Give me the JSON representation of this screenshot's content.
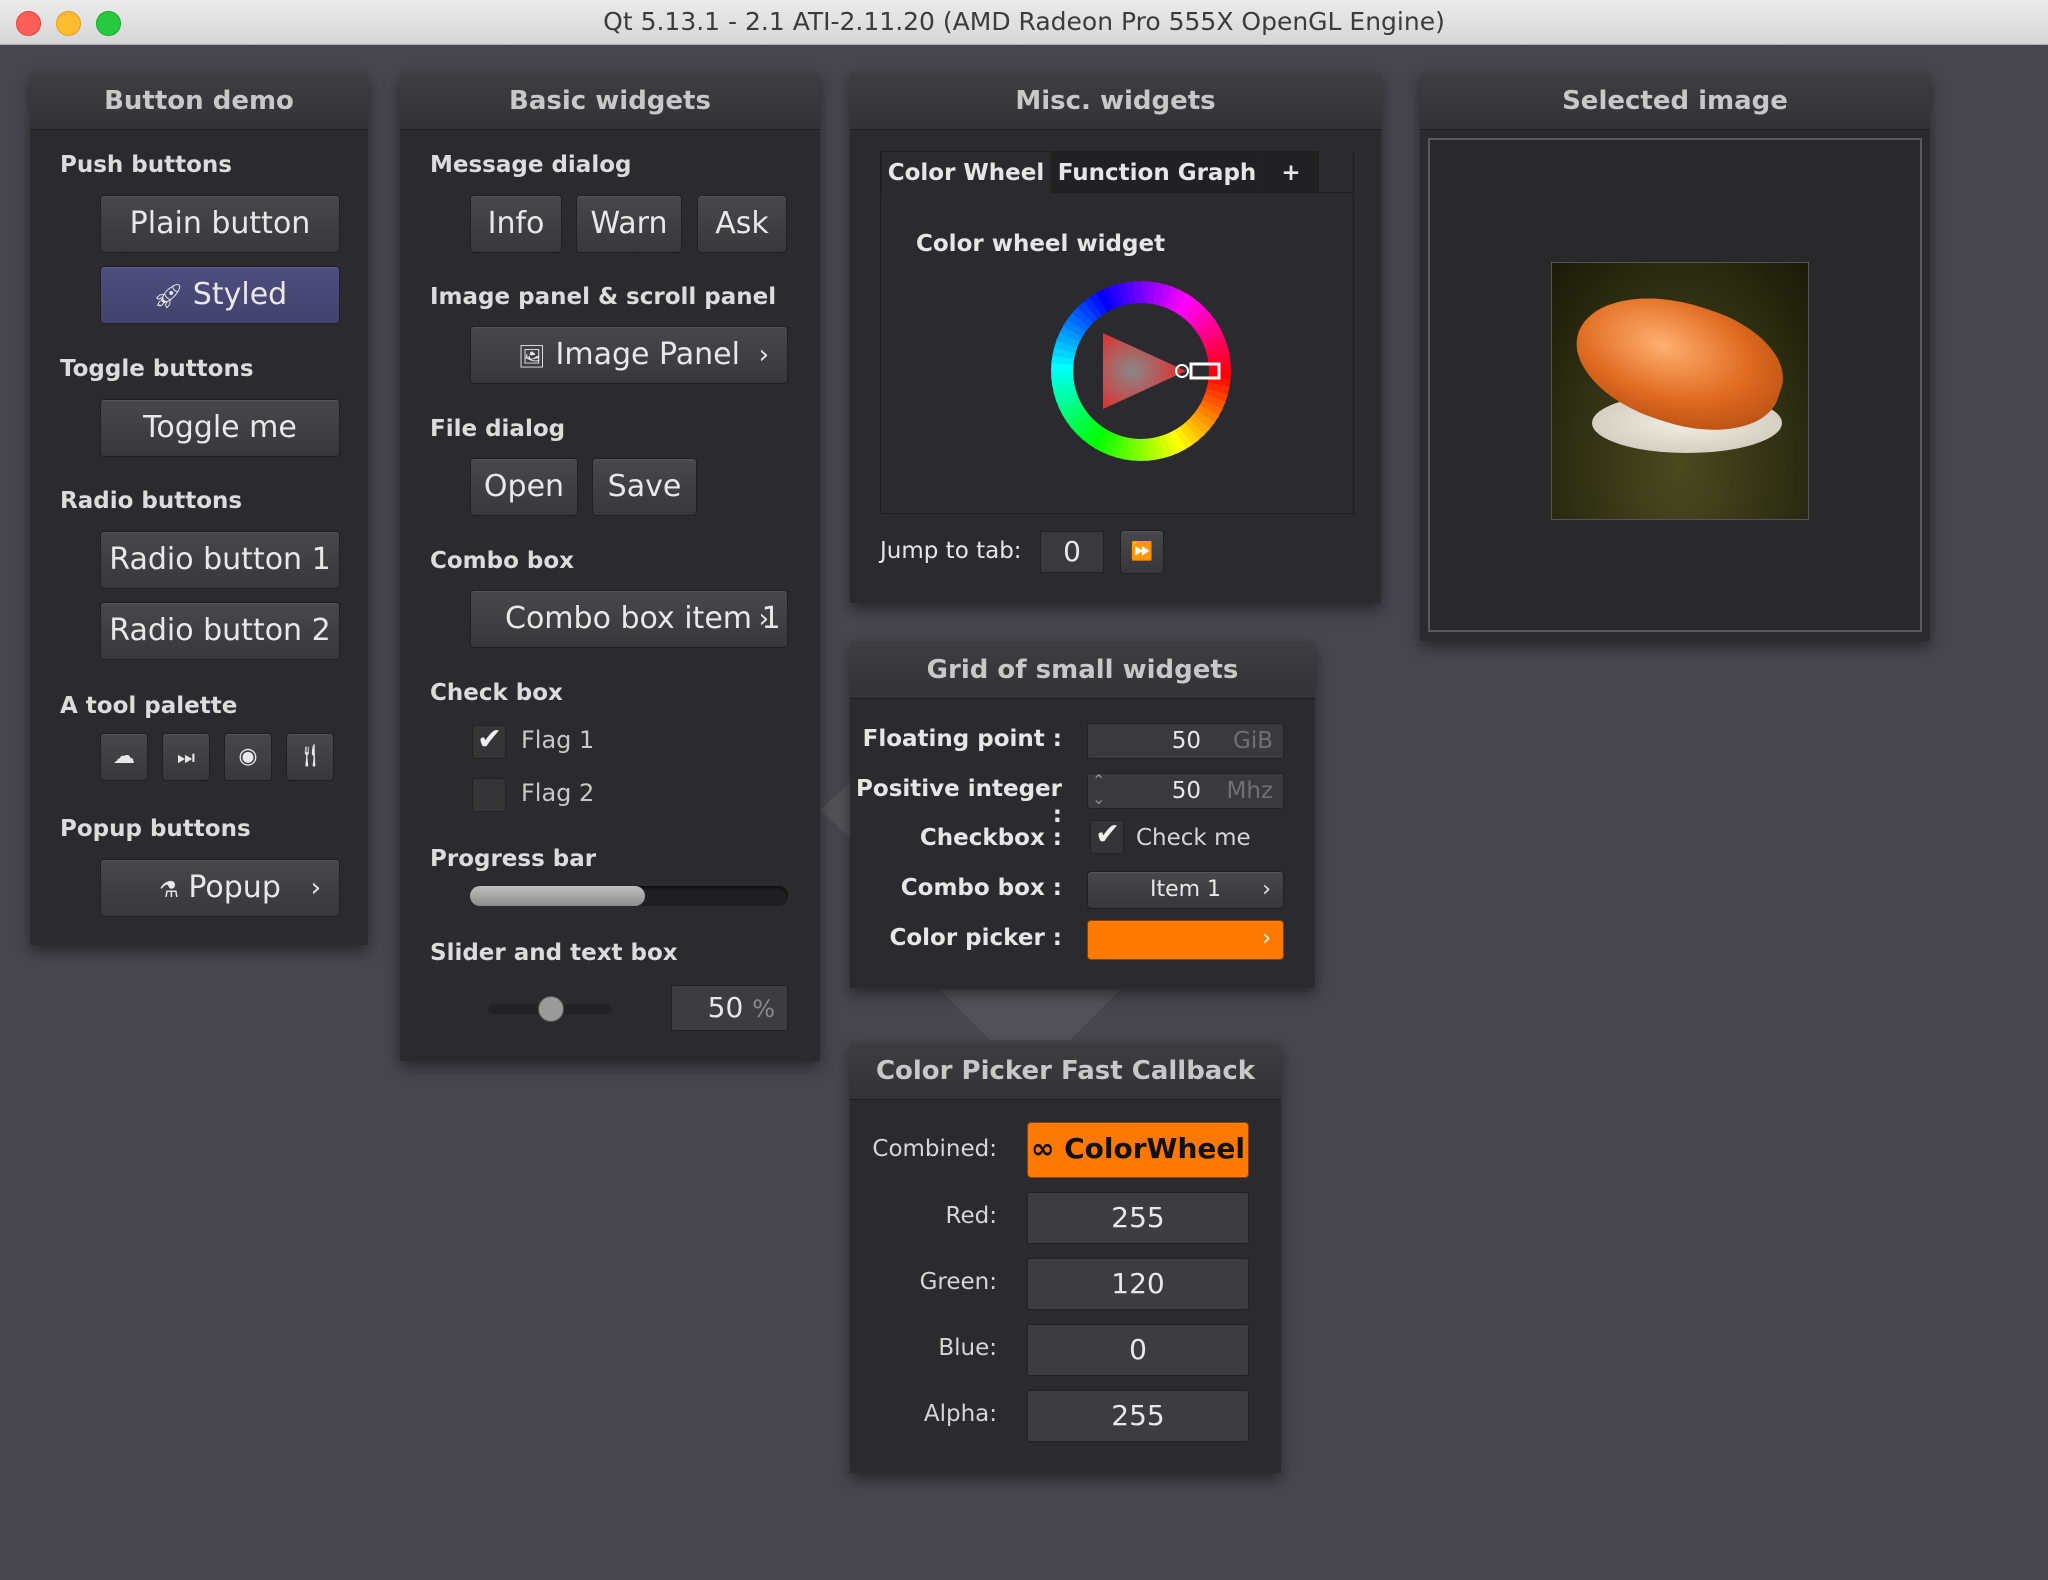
{
  "window": {
    "title": "Qt 5.13.1 - 2.1 ATI-2.11.20 (AMD Radeon Pro 555X OpenGL Engine)"
  },
  "button_demo": {
    "title": "Button demo",
    "push_label": "Push buttons",
    "plain_button": "Plain button",
    "styled_button": "Styled",
    "toggle_label": "Toggle buttons",
    "toggle_button": "Toggle me",
    "radio_label": "Radio buttons",
    "radio1": "Radio button 1",
    "radio2": "Radio button 2",
    "palette_label": "A tool palette",
    "popup_label": "Popup buttons",
    "popup_button": "Popup"
  },
  "basic_widgets": {
    "title": "Basic widgets",
    "message_label": "Message dialog",
    "info": "Info",
    "warn": "Warn",
    "ask": "Ask",
    "image_label": "Image panel & scroll panel",
    "image_panel": "Image Panel",
    "file_label": "File dialog",
    "open": "Open",
    "save": "Save",
    "combo_label": "Combo box",
    "combo_value": "Combo box item 1",
    "check_label": "Check box",
    "flag1": "Flag 1",
    "flag1_checked": true,
    "flag2": "Flag 2",
    "flag2_checked": false,
    "progress_label": "Progress bar",
    "progress": 0.55,
    "slider_label": "Slider and text box",
    "slider_value": "50",
    "slider_unit": "%",
    "slider_fraction": 0.5
  },
  "misc_widgets": {
    "title": "Misc. widgets",
    "tabs": [
      "Color Wheel",
      "Function Graph",
      "+"
    ],
    "active_tab": "Color Wheel",
    "color_wheel_label": "Color wheel widget",
    "jump_label": "Jump to tab:",
    "jump_value": "0"
  },
  "grid": {
    "title": "Grid of small widgets",
    "float_label": "Floating point :",
    "float_value": "50",
    "float_unit": "GiB",
    "int_label": "Positive integer :",
    "int_value": "50",
    "int_unit": "Mhz",
    "checkbox_label": "Checkbox :",
    "checkbox_text": "Check me",
    "combo_label": "Combo box :",
    "combo_value": "Item 1",
    "color_label": "Color picker :",
    "color_value": "#ff7800"
  },
  "color_picker": {
    "title": "Color Picker Fast Callback",
    "combined_label": "Combined:",
    "combined_button": "ColorWheel",
    "red_label": "Red:",
    "red": "255",
    "green_label": "Green:",
    "green": "120",
    "blue_label": "Blue:",
    "blue": "0",
    "alpha_label": "Alpha:",
    "alpha": "255"
  },
  "selected_image": {
    "title": "Selected image"
  },
  "colors": {
    "accent_orange": "#ff7800",
    "styled_button": "#4a4a78",
    "background": "#47464d"
  }
}
